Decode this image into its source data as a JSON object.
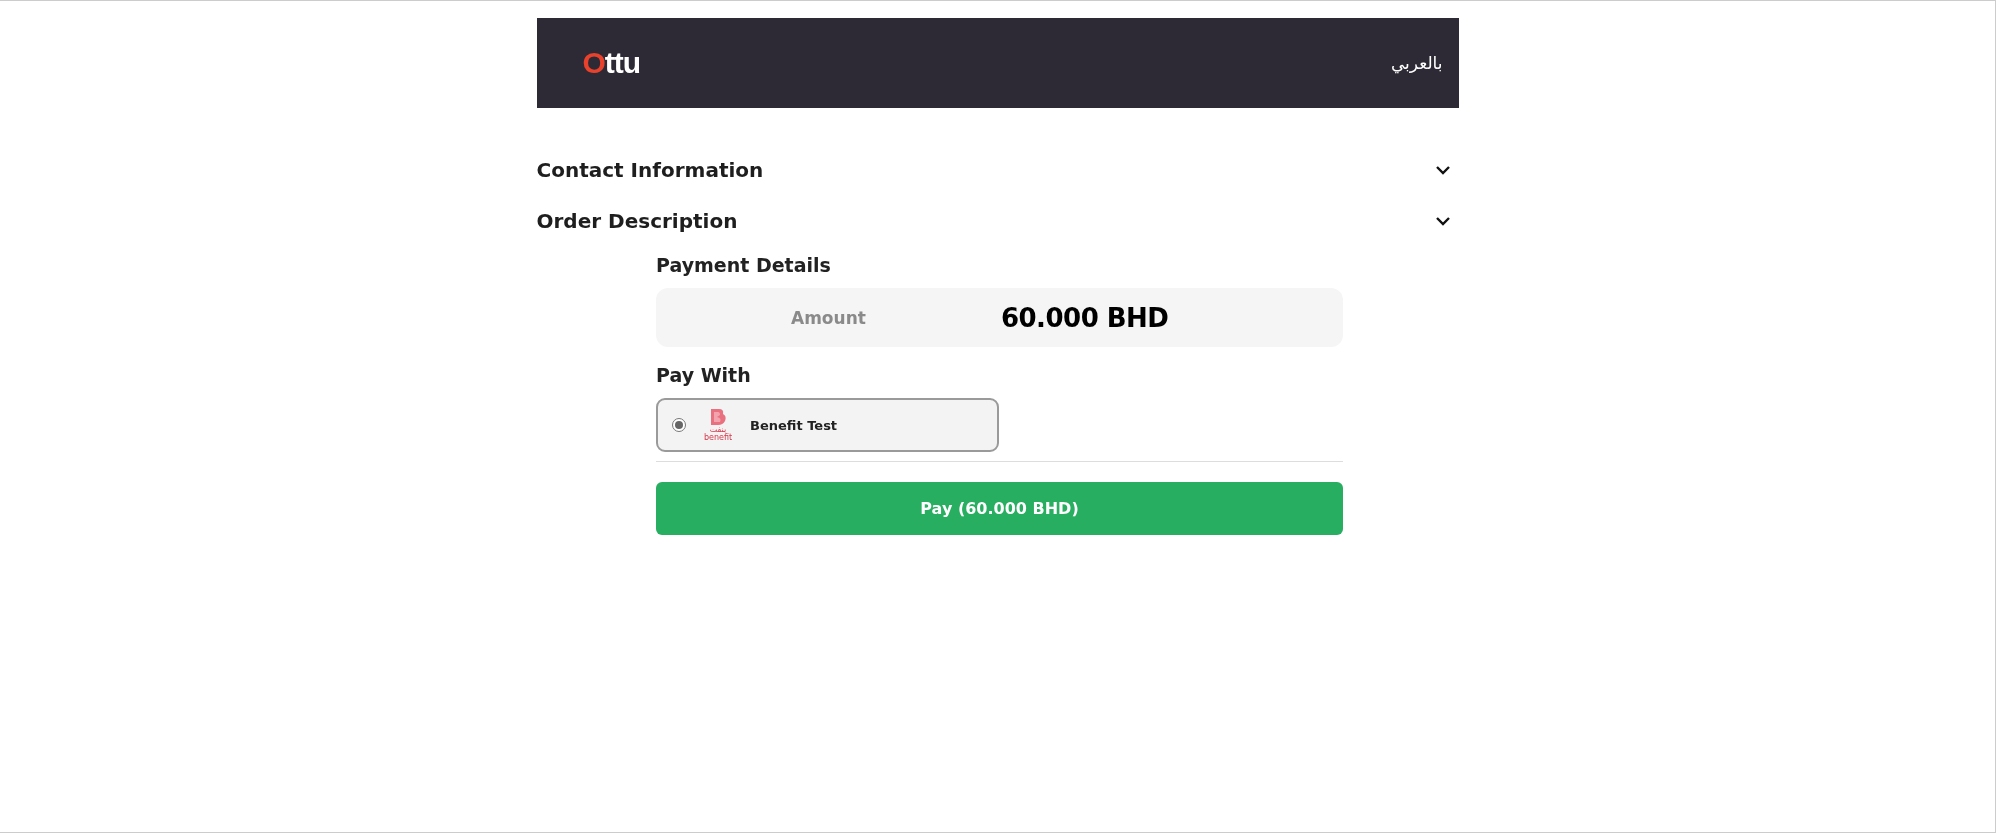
{
  "header": {
    "logo": "Ottu",
    "language_link": "بالعربي"
  },
  "sections": [
    {
      "title": "Contact Information",
      "expanded": false
    },
    {
      "title": "Order Description",
      "expanded": false
    }
  ],
  "payment": {
    "title": "Payment Details",
    "amount_label": "Amount",
    "amount_value": "60.000",
    "currency": "BHD",
    "pay_with_label": "Pay With",
    "methods": [
      {
        "name": "Benefit Test",
        "logo_text": "benefit",
        "logo_arabic": "بنفت",
        "selected": true
      }
    ],
    "pay_button": "Pay (60.000 BHD)"
  }
}
